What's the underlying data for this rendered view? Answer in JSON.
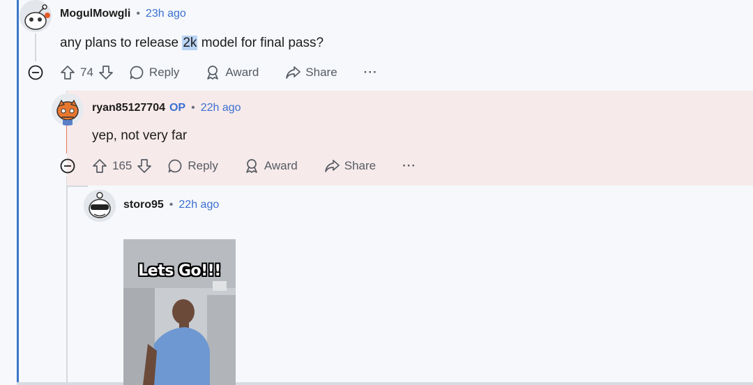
{
  "comments": [
    {
      "author": "MogulMowgli",
      "op_badge": "",
      "separator": "•",
      "time": "23h ago",
      "body_pre": "any plans to release ",
      "body_highlight": "2k",
      "body_post": " model for final pass?",
      "votes": "74",
      "reply_label": "Reply",
      "award_label": "Award",
      "share_label": "Share",
      "more_label": "···"
    },
    {
      "author": "ryan85127704",
      "op_badge": "OP",
      "separator": "•",
      "time": "22h ago",
      "body": "yep, not very far",
      "votes": "165",
      "reply_label": "Reply",
      "award_label": "Award",
      "share_label": "Share",
      "more_label": "···"
    },
    {
      "author": "storo95",
      "separator": "•",
      "time": "22h ago",
      "gif_caption": "Lets Go!!!"
    }
  ],
  "colors": {
    "accent": "#3b6fd1",
    "highlight_bg": "#f7eaea",
    "thread_line": "#d5d9de",
    "op_thread_line": "#e0765a"
  }
}
